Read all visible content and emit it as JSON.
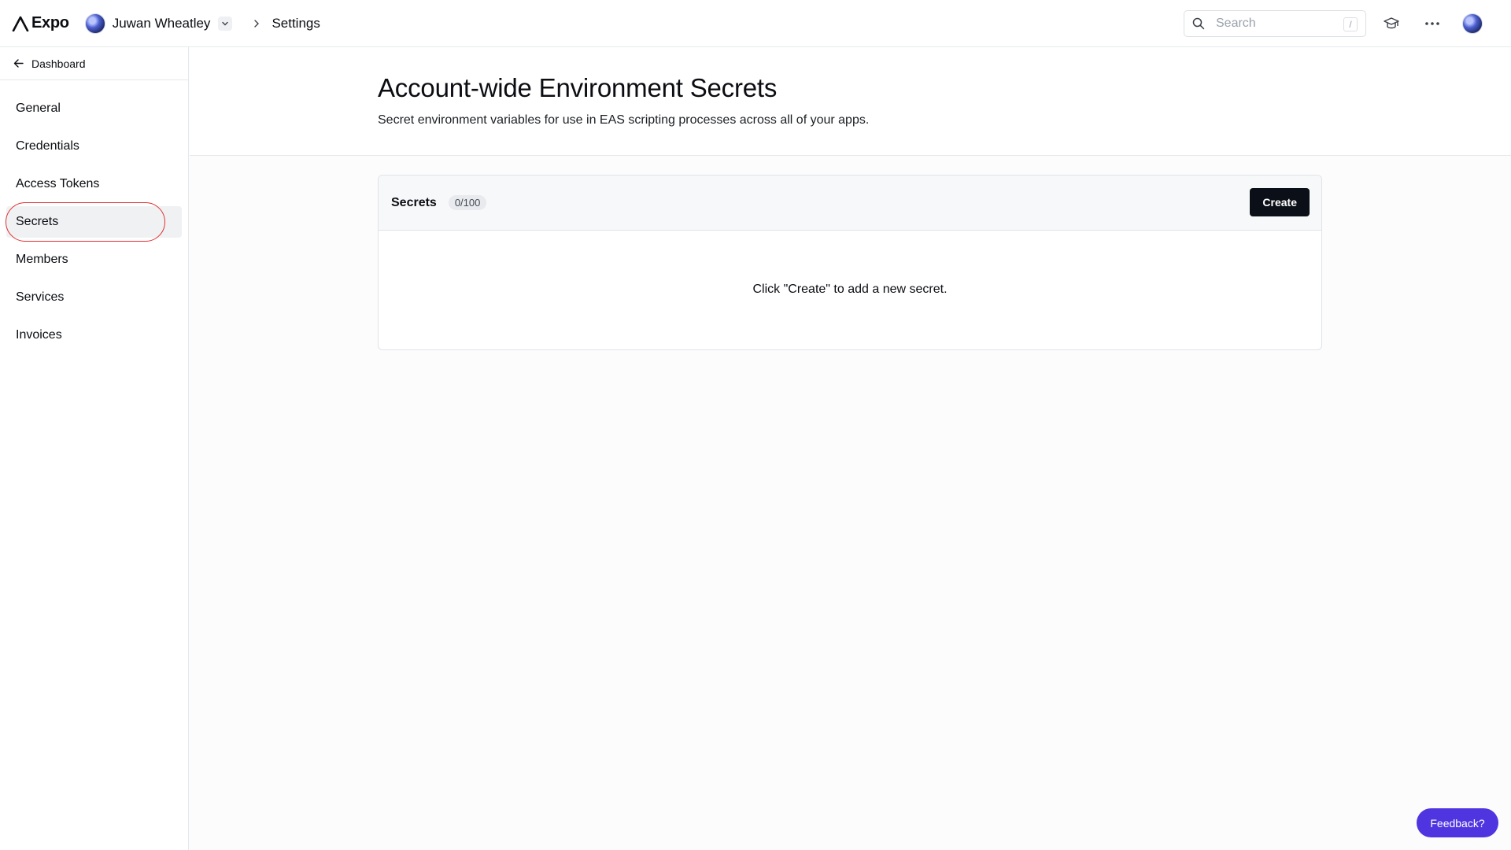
{
  "app": {
    "brand": "Expo"
  },
  "header": {
    "account_name": "Juwan Wheatley",
    "breadcrumb": "Settings",
    "search": {
      "placeholder": "Search",
      "shortcut": "/"
    }
  },
  "sidebar": {
    "back_label": "Dashboard",
    "items": [
      {
        "label": "General",
        "active": false
      },
      {
        "label": "Credentials",
        "active": false
      },
      {
        "label": "Access Tokens",
        "active": false
      },
      {
        "label": "Secrets",
        "active": true
      },
      {
        "label": "Members",
        "active": false
      },
      {
        "label": "Services",
        "active": false
      },
      {
        "label": "Invoices",
        "active": false
      }
    ]
  },
  "main": {
    "title": "Account-wide Environment Secrets",
    "subtitle": "Secret environment variables for use in EAS scripting processes across all of your apps.",
    "secrets_card": {
      "title": "Secrets",
      "count": "0/100",
      "create_label": "Create",
      "empty_message": "Click \"Create\" to add a new secret."
    }
  },
  "feedback_label": "Feedback?",
  "colors": {
    "accent_feedback": "#4f35e0",
    "primary_button": "#0b0f18",
    "annotation": "#e03131"
  },
  "icons": [
    "expo-logo-icon",
    "chevron-down-icon",
    "chevron-right-icon",
    "search-icon",
    "graduation-cap-icon",
    "more-horizontal-icon",
    "arrow-left-icon"
  ]
}
